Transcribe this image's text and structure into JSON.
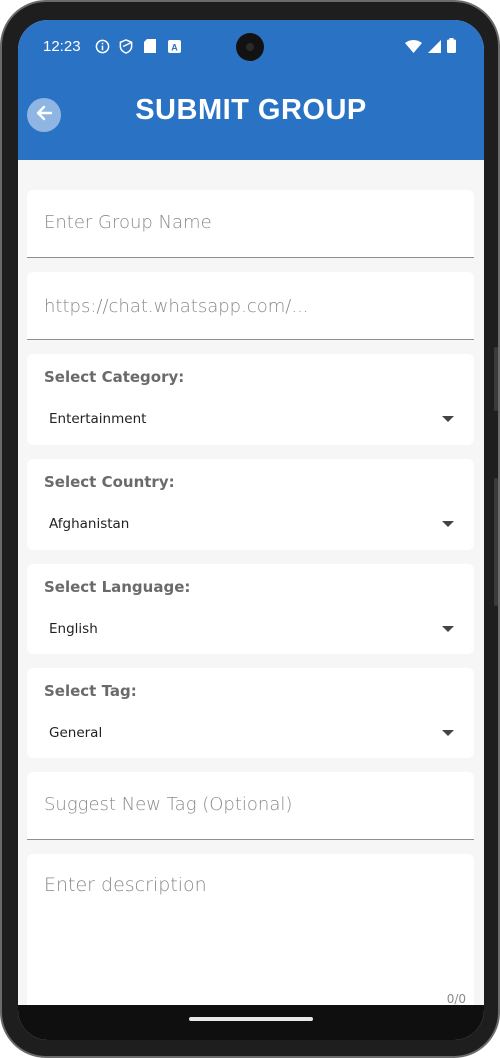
{
  "status_bar": {
    "time": "12:23"
  },
  "header": {
    "title": "SUBMIT GROUP"
  },
  "form": {
    "group_name_placeholder": "Enter Group Name",
    "link_placeholder": "https://chat.whatsapp.com/...",
    "category": {
      "label": "Select Category:",
      "value": "Entertainment"
    },
    "country": {
      "label": "Select Country:",
      "value": "Afghanistan"
    },
    "language": {
      "label": "Select Language:",
      "value": "English"
    },
    "tag": {
      "label": "Select Tag:",
      "value": "General"
    },
    "suggest_tag_placeholder": "Suggest New Tag (Optional)",
    "description_placeholder": "Enter description",
    "description_counter": "0/0"
  },
  "colors": {
    "header": "#2a73c4",
    "background": "#f6f6f6"
  },
  "icons": [
    "info-icon",
    "shield-icon",
    "sd-card-icon",
    "a-box-icon",
    "wifi-icon",
    "signal-icon",
    "battery-icon",
    "back-arrow-icon"
  ]
}
